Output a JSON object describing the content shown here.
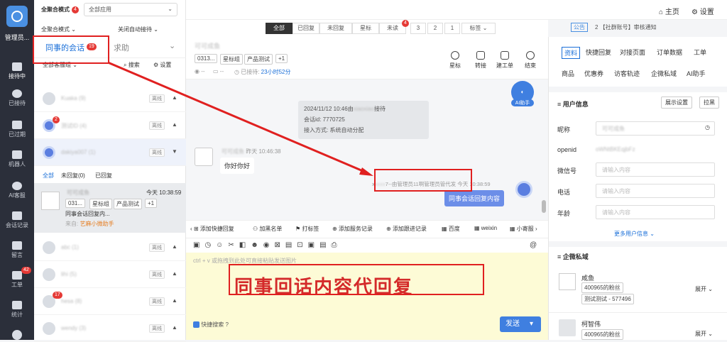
{
  "nav": {
    "admin_label": "管理员...",
    "items": [
      {
        "label": "接待中"
      },
      {
        "label": "已接待"
      },
      {
        "label": "已过期"
      },
      {
        "label": "机器人"
      },
      {
        "label": "AI客服"
      },
      {
        "label": "会话记录"
      },
      {
        "label": "留言"
      },
      {
        "label": "工单",
        "badge": "42"
      },
      {
        "label": "统计"
      }
    ]
  },
  "left": {
    "mode_label": "全聚合模式",
    "mode_badge": "4",
    "app_select": "全部应用",
    "sub_mode": "全聚合模式",
    "auto_reception": "关闭自动接待",
    "tab_colleague": "同事的会话",
    "tab_colleague_badge": "19",
    "tab_help": "求助",
    "group_select": "全部客服组",
    "search": "搜索",
    "settings": "设置",
    "offline": "离线",
    "subtabs": [
      "全部",
      "未回复(0)",
      "已回复"
    ],
    "conv": {
      "time": "今天 10:38:59",
      "tags": [
        "031...",
        "星标组",
        "产品测试",
        "+1"
      ],
      "preview": "同事会话回复内...",
      "source_prefix": "来自",
      "source": "艺麻小微助手"
    },
    "badge_a": "2",
    "badge_b": "17"
  },
  "top": {
    "home": "主页",
    "settings": "设置",
    "notice_label": "公告",
    "notice_text": "2 【社群账号】审核通知"
  },
  "filters": [
    "全部",
    "已回复",
    "未回复",
    "星标",
    "未读",
    "3",
    "2",
    "1",
    "标签"
  ],
  "filter_badge": "4",
  "chat": {
    "tags": [
      "0313...",
      "星标组",
      "产品测试",
      "+1"
    ],
    "received": "已接待:",
    "duration": "23小时52分",
    "dash1": "--",
    "dash2": "--",
    "actions": [
      "星标",
      "转接",
      "建工单",
      "结束"
    ],
    "ai_label": "AI助手",
    "sys_line1": "2024/11/12 10:46由",
    "sys_line1b": "接待",
    "sys_line2": "会话id: 7770725",
    "sys_line3": "接入方式: 系统自动分配",
    "msg_time": "昨天 10:46:38",
    "msg_text": "你好你好",
    "agent_meta_pre": "x",
    "agent_meta_note": "7--由管理员11啊管理员管代发",
    "agent_time": "今天 10:38:59",
    "agent_msg": "同事会话回复内容"
  },
  "toolbar": [
    "添加快捷回复",
    "加黑名单",
    "打标签",
    "添加服务记录",
    "添加跟进记录",
    "百度",
    "weixin",
    "小寄服"
  ],
  "compose": {
    "placeholder": "ctrl + v 或拖拽到此处可直接粘贴发送图片",
    "annotation": "同事回话内容代回复",
    "quick_search": "快捷搜索",
    "send": "发送"
  },
  "right": {
    "tabs1": [
      "资料",
      "快捷回复",
      "对接页面",
      "订单数据",
      "工单"
    ],
    "tabs2": [
      "商品",
      "优惠券",
      "访客轨迹",
      "企微私域",
      "AI助手"
    ],
    "user_info": "用户信息",
    "show_settings": "展示设置",
    "pull": "拉黑",
    "fields": [
      {
        "label": "昵称",
        "value": ""
      },
      {
        "label": "openid",
        "value": ""
      },
      {
        "label": "微信号",
        "placeholder": "请输入内容"
      },
      {
        "label": "电话",
        "placeholder": "请输入内容"
      },
      {
        "label": "年龄",
        "placeholder": "请输入内容"
      }
    ],
    "more_info": "更多用户信息",
    "wecom_title": "企微私域",
    "contacts": [
      {
        "name": "咸鱼",
        "tag1": "400965的粉丝",
        "tag2": "测试测试 - 577496",
        "expand": "展开"
      },
      {
        "name": "柯智伟",
        "tag1": "400965的粉丝",
        "expand": "展开"
      }
    ]
  }
}
